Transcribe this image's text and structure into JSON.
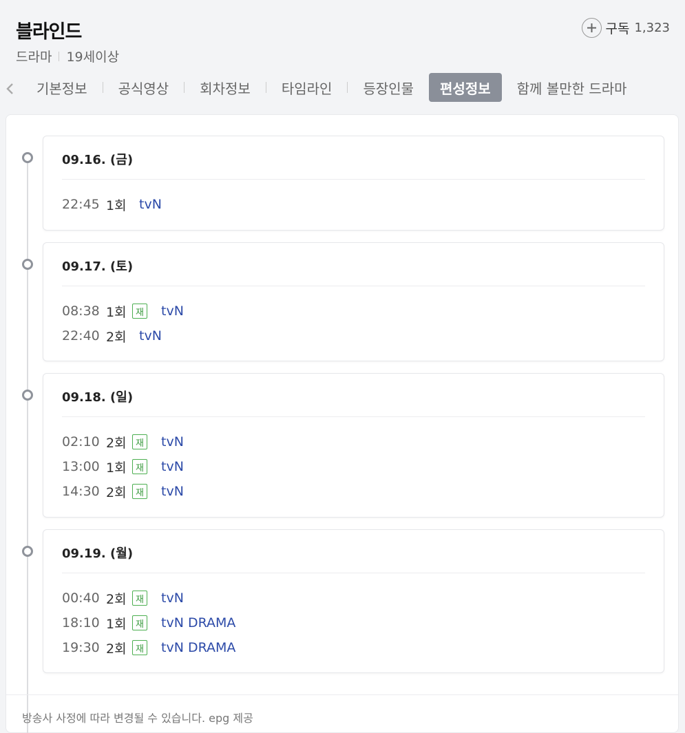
{
  "header": {
    "title": "블라인드",
    "genre": "드라마",
    "rating": "19세이상",
    "subscribe_label": "구독",
    "subscribe_count": "1,323"
  },
  "tabs": [
    {
      "label": "기본정보"
    },
    {
      "label": "공식영상"
    },
    {
      "label": "회차정보"
    },
    {
      "label": "타임라인"
    },
    {
      "label": "등장인물"
    },
    {
      "label": "편성정보",
      "active": true
    },
    {
      "label": "함께 볼만한 드라마"
    }
  ],
  "schedule": [
    {
      "date": "09.16. (금)",
      "items": [
        {
          "time": "22:45",
          "episode": "1회",
          "rerun": false,
          "channel": "tvN"
        }
      ]
    },
    {
      "date": "09.17. (토)",
      "items": [
        {
          "time": "08:38",
          "episode": "1회",
          "rerun": true,
          "channel": "tvN"
        },
        {
          "time": "22:40",
          "episode": "2회",
          "rerun": false,
          "channel": "tvN"
        }
      ]
    },
    {
      "date": "09.18. (일)",
      "items": [
        {
          "time": "02:10",
          "episode": "2회",
          "rerun": true,
          "channel": "tvN"
        },
        {
          "time": "13:00",
          "episode": "1회",
          "rerun": true,
          "channel": "tvN"
        },
        {
          "time": "14:30",
          "episode": "2회",
          "rerun": true,
          "channel": "tvN"
        }
      ]
    },
    {
      "date": "09.19. (월)",
      "items": [
        {
          "time": "00:40",
          "episode": "2회",
          "rerun": true,
          "channel": "tvN"
        },
        {
          "time": "18:10",
          "episode": "1회",
          "rerun": true,
          "channel": "tvN DRAMA"
        },
        {
          "time": "19:30",
          "episode": "2회",
          "rerun": true,
          "channel": "tvN DRAMA"
        }
      ]
    }
  ],
  "rerun_label": "재",
  "footer_note": "방송사 사정에 따라 변경될 수 있습니다. epg 제공",
  "colors": {
    "active_tab_bg": "#8a8f99",
    "channel_link": "#2c4aa8",
    "rerun_badge": "#4caf50"
  }
}
